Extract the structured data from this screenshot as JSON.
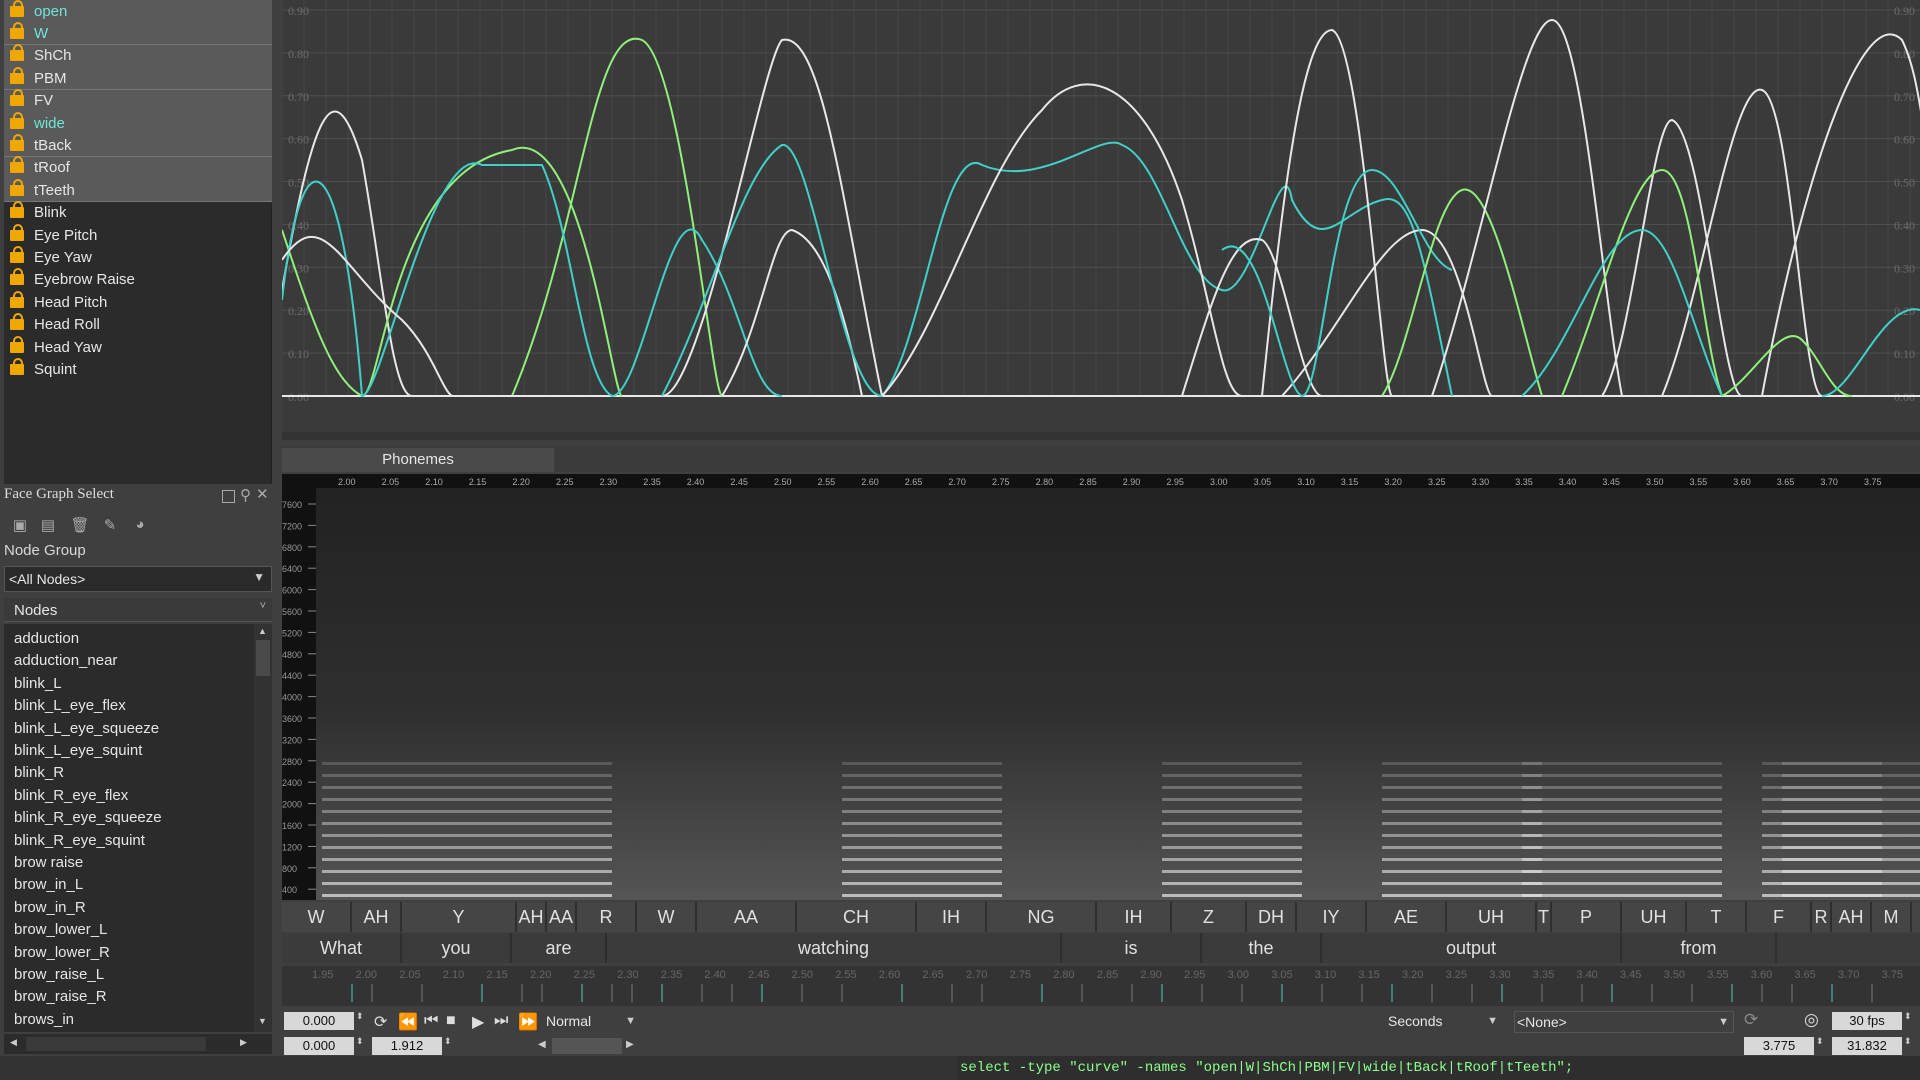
{
  "curves": [
    {
      "label": "open",
      "selected": true,
      "accent": true
    },
    {
      "label": "W",
      "selected": true,
      "accent": true
    },
    {
      "label": "ShCh",
      "selected": true,
      "accent": false
    },
    {
      "label": "PBM",
      "selected": true,
      "accent": false
    },
    {
      "label": "FV",
      "selected": true,
      "accent": false
    },
    {
      "label": "wide",
      "selected": true,
      "accent": true
    },
    {
      "label": "tBack",
      "selected": true,
      "accent": false
    },
    {
      "label": "tRoof",
      "selected": true,
      "accent": false
    },
    {
      "label": "tTeeth",
      "selected": true,
      "accent": false
    },
    {
      "label": "Blink",
      "selected": false,
      "accent": false
    },
    {
      "label": "Eye Pitch",
      "selected": false,
      "accent": false
    },
    {
      "label": "Eye Yaw",
      "selected": false,
      "accent": false
    },
    {
      "label": "Eyebrow Raise",
      "selected": false,
      "accent": false
    },
    {
      "label": "Head Pitch",
      "selected": false,
      "accent": false
    },
    {
      "label": "Head Roll",
      "selected": false,
      "accent": false
    },
    {
      "label": "Head Yaw",
      "selected": false,
      "accent": false
    },
    {
      "label": "Squint",
      "selected": false,
      "accent": false
    }
  ],
  "graph": {
    "y_ticks": [
      "0.90",
      "0.80",
      "0.70",
      "0.60",
      "0.50",
      "0.40",
      "0.30",
      "0.20",
      "0.10",
      "0.00"
    ],
    "colors": {
      "white": "#e8e8e8",
      "teal": "#3fd1c8",
      "green": "#8ff07a"
    }
  },
  "face_graph": {
    "title": "Face Graph Select",
    "node_group_label": "Node Group",
    "node_group_value": "<All Nodes>",
    "nodes_header": "Nodes",
    "nodes": [
      "adduction",
      "adduction_near",
      "blink_L",
      "blink_L_eye_flex",
      "blink_L_eye_squeeze",
      "blink_L_eye_squint",
      "blink_R",
      "blink_R_eye_flex",
      "blink_R_eye_squeeze",
      "blink_R_eye_squint",
      "brow raise",
      "brow_in_L",
      "brow_in_R",
      "brow_lower_L",
      "brow_lower_R",
      "brow_raise_L",
      "brow_raise_R",
      "brows_in"
    ]
  },
  "phonemes_tab": "Phonemes",
  "time_ticks": [
    "2.00",
    "2.05",
    "2.10",
    "2.15",
    "2.20",
    "2.25",
    "2.30",
    "2.35",
    "2.40",
    "2.45",
    "2.50",
    "2.55",
    "2.60",
    "2.65",
    "2.70",
    "2.75",
    "2.80",
    "2.85",
    "2.90",
    "2.95",
    "3.00",
    "3.05",
    "3.10",
    "3.15",
    "3.20",
    "3.25",
    "3.30",
    "3.35",
    "3.40",
    "3.45",
    "3.50",
    "3.55",
    "3.60",
    "3.65",
    "3.70",
    "3.75"
  ],
  "freq_ticks": [
    "7600",
    "7200",
    "6800",
    "6400",
    "6000",
    "5600",
    "5200",
    "4800",
    "4400",
    "4000",
    "3600",
    "3200",
    "2800",
    "2400",
    "2000",
    "1600",
    "1200",
    "800",
    "400"
  ],
  "phonemes": [
    "W",
    "AH",
    "Y",
    "AH",
    "AA",
    "R",
    "W",
    "AA",
    "CH",
    "IH",
    "NG",
    "IH",
    "Z",
    "DH",
    "IY",
    "AE",
    "UH",
    "T",
    "P",
    "UH",
    "T",
    "F",
    "R",
    "AH",
    "M"
  ],
  "words": [
    "What",
    "you",
    "are",
    "watching",
    "is",
    "the",
    "output",
    "from"
  ],
  "timeline_ticks": [
    "1.95",
    "2.00",
    "2.05",
    "2.10",
    "2.15",
    "2.20",
    "2.25",
    "2.30",
    "2.35",
    "2.40",
    "2.45",
    "2.50",
    "2.55",
    "2.60",
    "2.65",
    "2.70",
    "2.75",
    "2.80",
    "2.85",
    "2.90",
    "2.95",
    "3.00",
    "3.05",
    "3.10",
    "3.15",
    "3.20",
    "3.25",
    "3.30",
    "3.35",
    "3.40",
    "3.45",
    "3.50",
    "3.55",
    "3.60",
    "3.65",
    "3.70",
    "3.75"
  ],
  "transport": {
    "start_time": "0.000",
    "range_start": "0.000",
    "range_end": "1.912",
    "speed": "Normal",
    "units": "Seconds",
    "target": "<None>",
    "current_time": "3.775",
    "end_time": "31.832",
    "fps": "30 fps"
  },
  "command_line": "select -type \"curve\" -names \"open|W|ShCh|PBM|FV|wide|tBack|tRoof|tTeeth\";"
}
